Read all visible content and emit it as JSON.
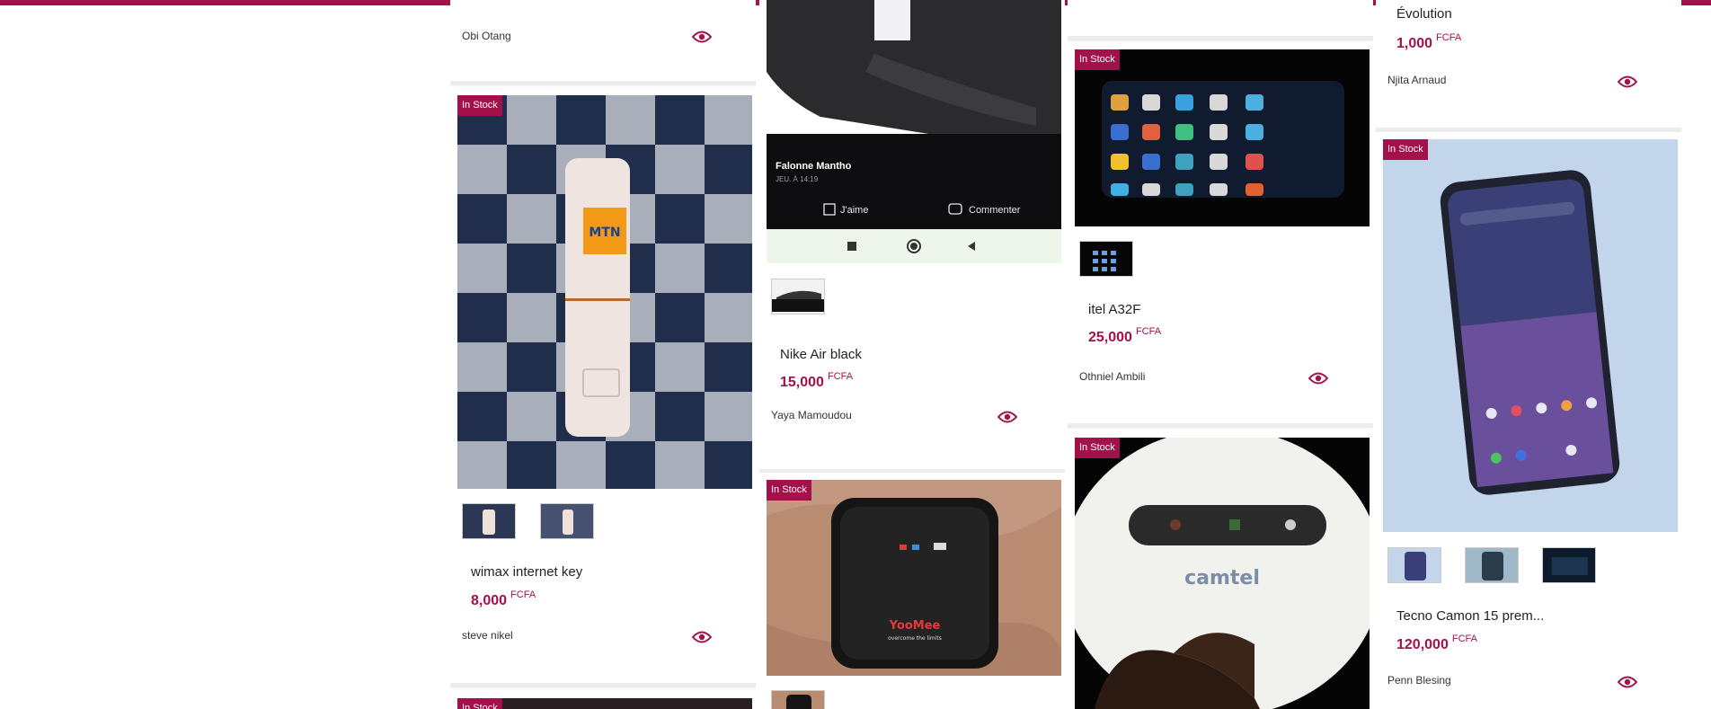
{
  "accent_color": "#a4104a",
  "cards": {
    "c1_top": {
      "seller": "Obi Otang"
    },
    "wimax": {
      "badge": "In Stock",
      "title": "wimax internet key",
      "price": "8,000",
      "currency": "FCFA",
      "seller": "steve nikel",
      "logo_text": "MTN"
    },
    "c1_bottom": {
      "badge": "In Stock"
    },
    "nike": {
      "title": "Nike Air black",
      "price": "15,000",
      "currency": "FCFA",
      "seller": "Yaya Mamoudou",
      "post_author": "Falonne Mantho",
      "post_time": "JEU. À 14:19",
      "like_label": "J'aime",
      "comment_label": "Commenter"
    },
    "yoomee": {
      "badge": "In Stock",
      "brand_text": "YooMee",
      "tagline": "overcome the limits"
    },
    "itel": {
      "badge": "In Stock",
      "title": "itel A32F",
      "price": "25,000",
      "currency": "FCFA",
      "seller": "Othniel Ambili"
    },
    "camtel": {
      "badge": "In Stock",
      "brand_text": "camtel"
    },
    "c4_top": {
      "title": "Évolution",
      "price": "1,000",
      "currency": "FCFA",
      "seller": "Njita Arnaud"
    },
    "tecno": {
      "badge": "In Stock",
      "title": "Tecno Camon 15 prem...",
      "price": "120,000",
      "currency": "FCFA",
      "seller": "Penn Blesing"
    }
  }
}
